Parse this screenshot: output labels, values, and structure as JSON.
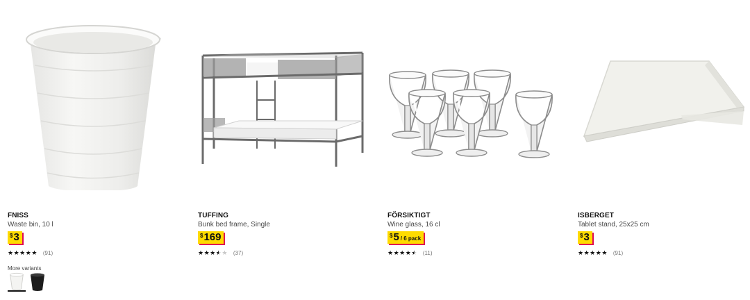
{
  "products": [
    {
      "name": "FNISS",
      "description": "Waste bin, 10 l",
      "price": {
        "currency": "$",
        "value": "3",
        "unit": ""
      },
      "rating": {
        "stars": 5,
        "count": "(91)"
      },
      "variants": {
        "label": "More variants",
        "options": [
          "white",
          "black"
        ]
      },
      "image_icon": "waste-bin"
    },
    {
      "name": "TUFFING",
      "description": "Bunk bed frame, Single",
      "price": {
        "currency": "$",
        "value": "169",
        "unit": ""
      },
      "rating": {
        "stars": 3.5,
        "count": "(37)"
      },
      "image_icon": "bunk-bed"
    },
    {
      "name": "FÖRSIKTIGT",
      "description": "Wine glass, 16 cl",
      "price": {
        "currency": "$",
        "value": "5",
        "unit": "/ 6 pack"
      },
      "rating": {
        "stars": 4.5,
        "count": "(11)"
      },
      "image_icon": "wine-glasses"
    },
    {
      "name": "ISBERGET",
      "description": "Tablet stand, 25x25 cm",
      "price": {
        "currency": "$",
        "value": "3",
        "unit": ""
      },
      "rating": {
        "stars": 5,
        "count": "(91)"
      },
      "image_icon": "tablet-stand"
    }
  ],
  "colors": {
    "price_bg": "#ffdb00",
    "price_shadow": "#e00751",
    "text": "#111111"
  }
}
